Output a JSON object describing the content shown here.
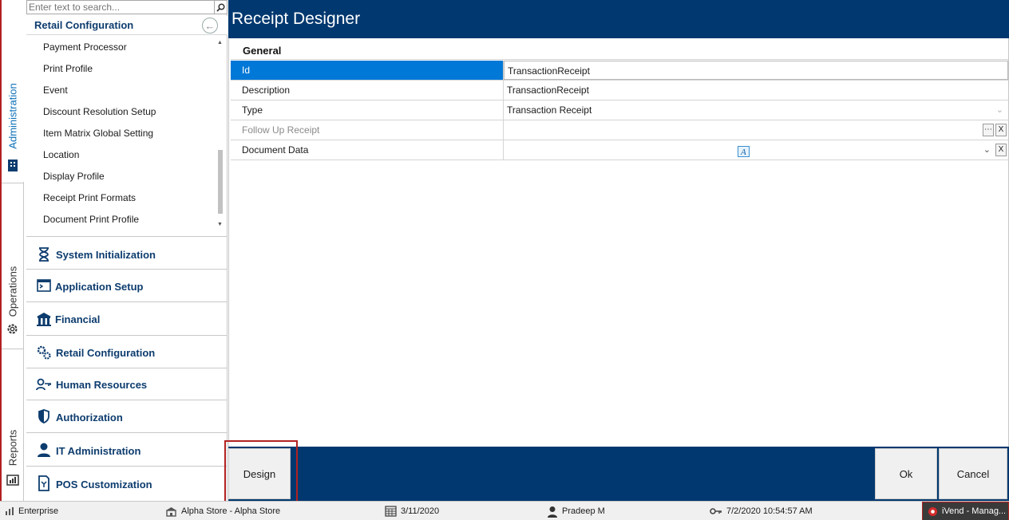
{
  "rail": {
    "tabs": [
      {
        "label": "Administration",
        "active": true,
        "icon": "building-icon"
      },
      {
        "label": "Operations",
        "active": false,
        "icon": "gear-icon"
      },
      {
        "label": "Reports",
        "active": false,
        "icon": "report-icon"
      }
    ]
  },
  "nav": {
    "search_placeholder": "Enter text to search...",
    "section_title": "Retail Configuration",
    "sub_items": [
      "Payment Processor",
      "Print Profile",
      "Event",
      "Discount Resolution Setup",
      "Item Matrix Global Setting",
      "Location",
      "Display Profile",
      "Receipt Print Formats",
      "Document Print Profile"
    ],
    "groups": [
      {
        "label": "System Initialization",
        "icon": "hourglass-icon"
      },
      {
        "label": "Application Setup",
        "icon": "terminal-icon"
      },
      {
        "label": "Financial",
        "icon": "bank-icon"
      },
      {
        "label": "Retail Configuration",
        "icon": "gears-icon"
      },
      {
        "label": "Human Resources",
        "icon": "user-key-icon"
      },
      {
        "label": "Authorization",
        "icon": "shield-icon"
      },
      {
        "label": "IT Administration",
        "icon": "person-icon"
      },
      {
        "label": "POS Customization",
        "icon": "pos-icon"
      }
    ]
  },
  "main": {
    "title": "Receipt Designer",
    "category": "General",
    "properties": [
      {
        "name": "Id",
        "value": "TransactionReceipt",
        "selected": true
      },
      {
        "name": "Description",
        "value": "TransactionReceipt"
      },
      {
        "name": "Type",
        "value": "Transaction Receipt"
      },
      {
        "name": "Follow Up Receipt",
        "value": "",
        "disabled": true
      },
      {
        "name": "Document Data",
        "value": ""
      }
    ],
    "buttons": {
      "design": "Design",
      "ok": "Ok",
      "cancel": "Cancel"
    }
  },
  "status": {
    "edition": "Enterprise",
    "store": "Alpha Store - Alpha Store",
    "business_date": "3/11/2020",
    "user": "Pradeep M",
    "login_time": "7/2/2020 10:54:57 AM",
    "app": "iVend - Manag..."
  },
  "colors": {
    "accent": "#00386f",
    "selection": "#0078d7",
    "nav_text": "#0d3c6e",
    "highlight_outline": "#b22222"
  }
}
